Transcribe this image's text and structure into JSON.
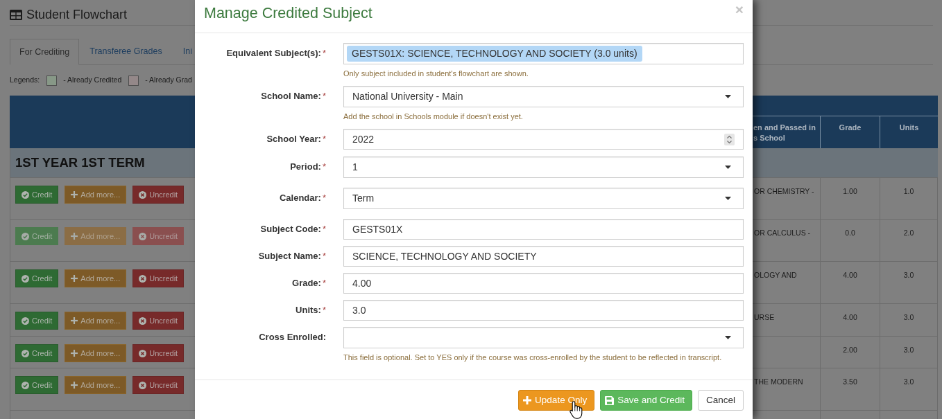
{
  "page": {
    "title": "Student Flowchart"
  },
  "tabs": [
    {
      "label": "For Crediting",
      "selected": true
    },
    {
      "label": "Transferee Grades",
      "selected": false
    },
    {
      "label": "Ini",
      "selected": false
    }
  ],
  "legend": {
    "label": "Legends:",
    "items": [
      {
        "label": "- Already Credited",
        "color": "#879887"
      },
      {
        "label": "- Already Grad",
        "color": "#948889"
      }
    ]
  },
  "table": {
    "columns": [
      {
        "lines": [
          "en and Passed in",
          "s School"
        ]
      },
      {
        "lines": [
          "Grade"
        ]
      },
      {
        "lines": [
          "Units"
        ]
      }
    ],
    "section": "1ST YEAR 1ST TERM",
    "rows": [
      {
        "disabled": false,
        "buttons": [
          {
            "kind": "credit",
            "label": "Credit"
          },
          {
            "kind": "add",
            "label": "Add more..."
          },
          {
            "kind": "uncredit",
            "label": "Uncredit"
          }
        ],
        "column_3": "OR CHEMISTRY -",
        "grade": "1.00",
        "units": "1.0"
      },
      {
        "disabled": true,
        "buttons": [
          {
            "kind": "credit",
            "label": "Credit"
          },
          {
            "kind": "add",
            "label": "Add more..."
          },
          {
            "kind": "uncredit",
            "label": "Uncredit"
          }
        ],
        "column_3": "OR CALCULUS -",
        "grade": "0.0",
        "units": "2.0"
      },
      {
        "disabled": false,
        "buttons": [
          {
            "kind": "credit",
            "label": "Credit"
          },
          {
            "kind": "add",
            "label": "Add more..."
          },
          {
            "kind": "uncredit",
            "label": "Uncredit"
          }
        ],
        "column_3": "OLOGY AND",
        "grade": "4.00",
        "units": "3.0"
      },
      {
        "disabled": false,
        "buttons": [
          {
            "kind": "credit",
            "label": "Credit"
          },
          {
            "kind": "add",
            "label": "Add more..."
          },
          {
            "kind": "uncredit",
            "label": "Uncredit"
          }
        ],
        "column_3": "URSE",
        "grade": "4.00",
        "units": "3.0"
      },
      {
        "disabled": false,
        "buttons": [
          {
            "kind": "credit",
            "label": "Credit"
          },
          {
            "kind": "add",
            "label": "Add more..."
          },
          {
            "kind": "uncredit",
            "label": "Uncredit"
          }
        ],
        "grade": "2.00",
        "units": "3.0"
      },
      {
        "disabled": false,
        "buttons": [
          {
            "kind": "credit",
            "label": "Credit"
          },
          {
            "kind": "add",
            "label": "Add more..."
          },
          {
            "kind": "uncredit",
            "label": "Uncredit"
          }
        ],
        "column_3": "THE MODERN",
        "grade": "3.50",
        "units": "3.0"
      }
    ]
  },
  "modal": {
    "title": "Manage Credited Subject",
    "close": "×",
    "fields": [
      {
        "label": "Equivalent Subject(s):",
        "required_mark": "*",
        "kind": "tags",
        "tags": [
          "GESTS01X: SCIENCE, TECHNOLOGY AND SOCIETY (3.0 units)"
        ],
        "help": "Only subject included in student's flowchart are shown."
      },
      {
        "label": "School Name:",
        "required_mark": "*",
        "kind": "select",
        "value": "National University - Main",
        "help": "Add the school in Schools module if doesn't exist yet."
      },
      {
        "label": "School Year:",
        "required_mark": "*",
        "kind": "number",
        "value": "2022"
      },
      {
        "label": "Period:",
        "required_mark": "*",
        "kind": "select",
        "value": "1"
      },
      {
        "label": "Calendar:",
        "required_mark": "*",
        "kind": "select",
        "value": "Term"
      },
      {
        "label": "Subject Code:",
        "required_mark": "*",
        "kind": "text",
        "value": "GESTS01X"
      },
      {
        "label": "Subject Name:",
        "required_mark": "*",
        "kind": "text",
        "value": "SCIENCE, TECHNOLOGY AND SOCIETY"
      },
      {
        "label": "Grade:",
        "required_mark": "*",
        "kind": "text",
        "value": "4.00"
      },
      {
        "label": "Units:",
        "required_mark": "*",
        "kind": "text",
        "value": "3.0"
      },
      {
        "label": "Cross Enrolled:",
        "kind": "select",
        "help": "This field is optional. Set to YES only if the course was cross-enrolled by the student to be reflected in transcript."
      }
    ],
    "buttons": [
      {
        "kind": "warning",
        "label": "Update Only"
      },
      {
        "kind": "success",
        "label": "Save and Credit"
      },
      {
        "kind": "default",
        "label": "Cancel"
      }
    ]
  }
}
